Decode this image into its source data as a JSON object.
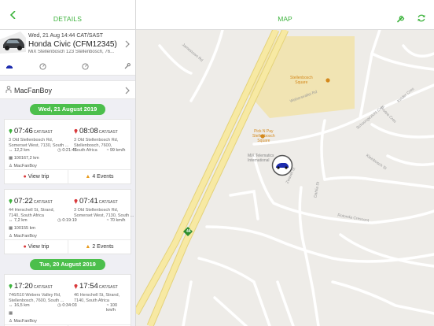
{
  "details": {
    "title": "DETAILS",
    "vehicle": {
      "date": "Wed, 21 Aug 14:44 CAT/SAST",
      "name": "Honda Civic (CFM12345)",
      "address": "MiX Stellenbosch 123 Stellenbosch, 76..."
    },
    "vehicle_icons": [
      "car-icon",
      "speedometer-icon",
      "speedometer-icon",
      "wrench-icon"
    ],
    "driver": "MacFanBoy",
    "groups": [
      {
        "date": "Wed, 21 August 2019",
        "trips": [
          {
            "start_time": "07:46",
            "start_tz": "CAT/SAST",
            "start_addr": [
              "3 Old Stellenbosch Rd,",
              "Somerset West, 7130, South ..."
            ],
            "end_time": "08:08",
            "end_tz": "CAT/SAST",
            "end_addr": [
              "3 Old Stellenbosch Rd,",
              "Stellenbosch, 7600,",
              "South Africa"
            ],
            "distance": "12,2 km",
            "duration": "0:21:45",
            "speed": "99 km/h",
            "odometer": "100167,2 km",
            "driver": "MacFanBoy",
            "view_label": "View trip",
            "events_label": "4 Events"
          },
          {
            "start_time": "07:22",
            "start_tz": "CAT/SAST",
            "start_addr": [
              "44 Herschell St, Strand,",
              "7140, South Africa"
            ],
            "end_time": "07:41",
            "end_tz": "CAT/SAST",
            "end_addr": [
              "3 Old Stellenbosch Rd,",
              "Somerset West, 7130, South ..."
            ],
            "distance": "7,2 km",
            "duration": "0:19:19",
            "speed": "70 km/h",
            "odometer": "100155 km",
            "driver": "MacFanBoy",
            "view_label": "View trip",
            "events_label": "2 Events"
          }
        ]
      },
      {
        "date": "Tue, 20 August 2019",
        "trips": [
          {
            "start_time": "17:20",
            "start_tz": "CAT/SAST",
            "start_addr": [
              "746/510 Webers Valley Rd,",
              "Stellenbosch, 7600, South ..."
            ],
            "end_time": "17:54",
            "end_tz": "CAT/SAST",
            "end_addr": [
              "46 Herschell St, Strand,",
              "7140, South Africa"
            ],
            "distance": "16,5 km",
            "duration": "0:34:03",
            "speed": "100 km/h",
            "odometer": "",
            "driver": "MacFanBoy",
            "view_label": "",
            "events_label": ""
          }
        ]
      }
    ]
  },
  "map": {
    "title": "MAP",
    "toolbar_icons": [
      "wrench-icon",
      "refresh-icon"
    ],
    "labels": {
      "stellenbosch_square": "Stellenbosch\nSquare",
      "pick_n_pay": "Pick N Pay\nStellenbosch\nSquare",
      "mix_telematics": "MiX Telematics\nInternational",
      "route": "44",
      "streets": [
        "Jamestown Rd",
        "Stellenbosch Square",
        "Webersvallei Rd",
        "Schoongezicht Cres",
        "Kleinbosch St",
        "Rotonda Crescent",
        "Dahlia St",
        "Zwavel St",
        "Protea Cres",
        "Kelder Cres"
      ]
    },
    "colors": {
      "accent": "#3db33d",
      "poi": "#d4891d",
      "road": "#f7e9a3",
      "square": "#f1e4b3",
      "vehicle": "#1d2cae"
    }
  }
}
